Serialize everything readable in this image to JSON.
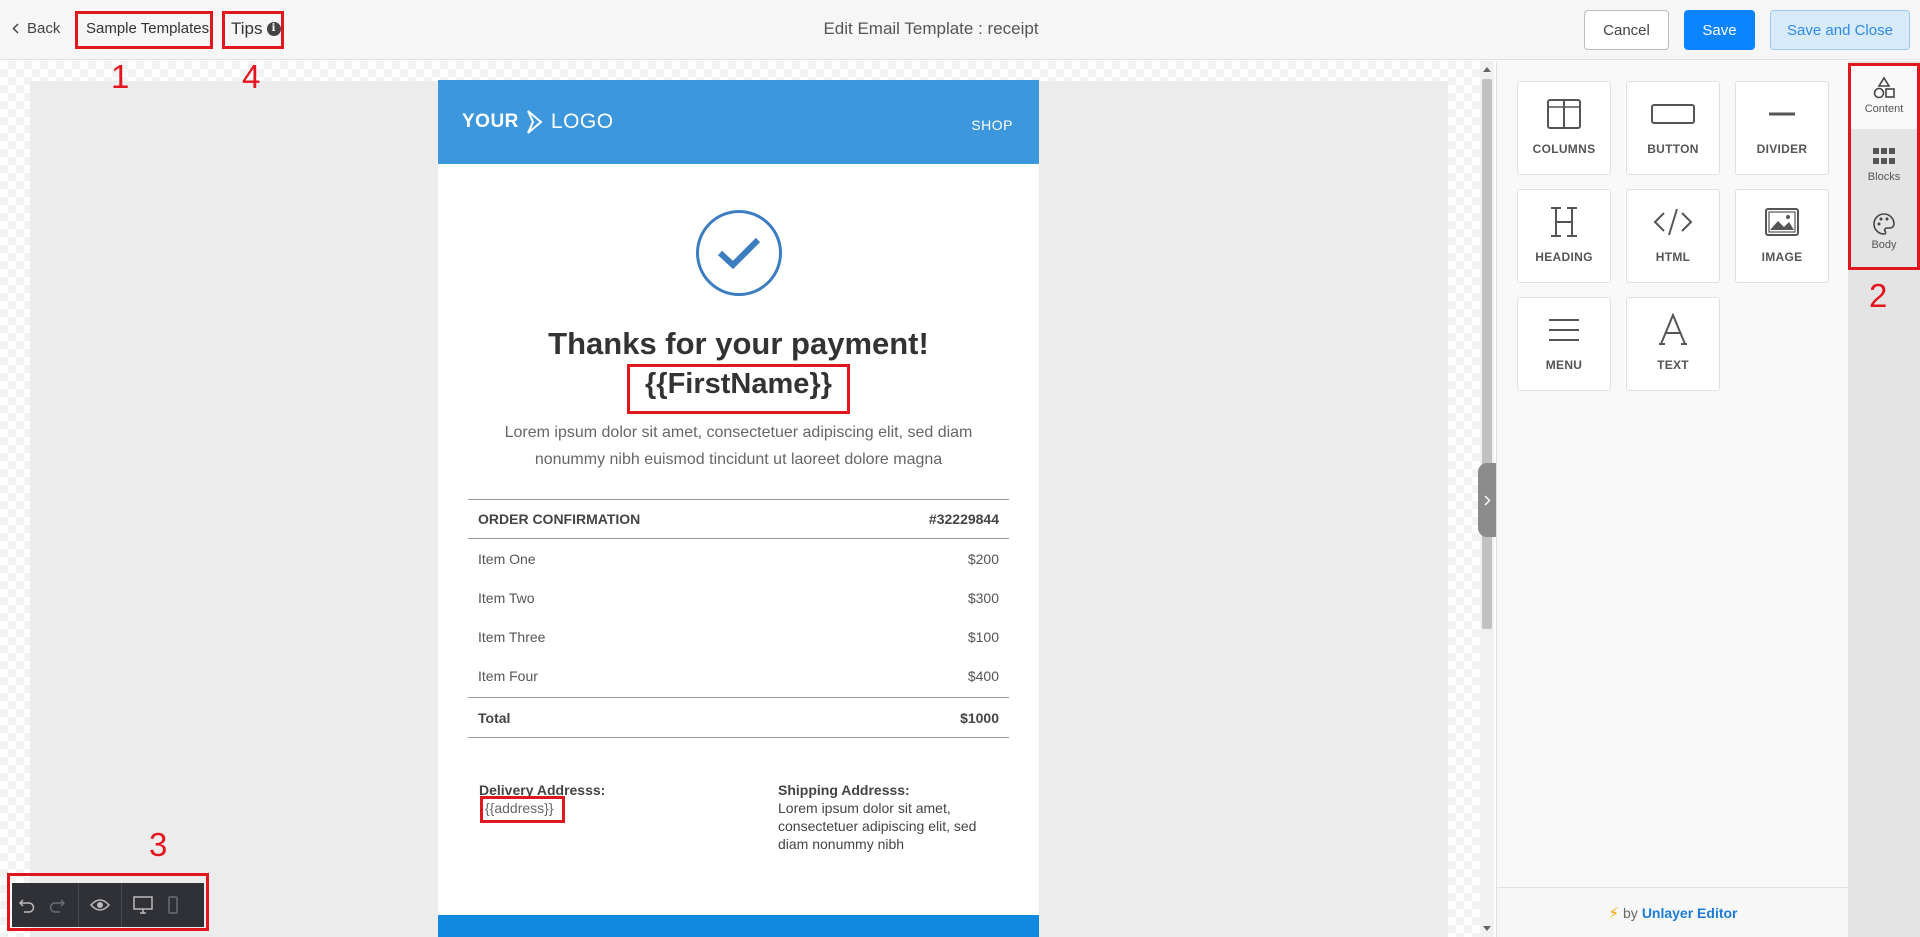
{
  "header": {
    "back_label": "Back",
    "templates_label": "Sample Templates",
    "tips_label": "Tips",
    "tips_info_glyph": "i",
    "title": "Edit Email Template : receipt",
    "cancel_label": "Cancel",
    "save_label": "Save",
    "save_close_label": "Save and Close"
  },
  "annotations": {
    "n1": "1",
    "n2": "2",
    "n3": "3",
    "n4": "4"
  },
  "email": {
    "logo_word1": "YOUR",
    "logo_word2": "LOGO",
    "shop_label": "SHOP",
    "heading": "Thanks for your payment!",
    "first_name_tag": "{{FirstName}}",
    "intro": "Lorem ipsum dolor sit amet, consectetuer adipiscing elit, sed diam nonummy nibh euismod tincidunt ut laoreet dolore magna",
    "order": {
      "title": "ORDER CONFIRMATION",
      "number": "#32229844",
      "items": [
        {
          "name": "Item One",
          "price": "$200"
        },
        {
          "name": "Item Two",
          "price": "$300"
        },
        {
          "name": "Item Three",
          "price": "$100"
        },
        {
          "name": "Item Four",
          "price": "$400"
        }
      ],
      "total_label": "Total",
      "total_value": "$1000"
    },
    "delivery_label": "Delivery Addresss:",
    "delivery_value": "{{address}}",
    "shipping_label": "Shipping Addresss:",
    "shipping_value": "Lorem ipsum dolor sit amet, consectetuer adipiscing elit, sed diam nonummy nibh",
    "colors": {
      "header": "#3c97dd",
      "check": "#3c7cc0",
      "footer": "#0f8ae0"
    }
  },
  "tools": [
    {
      "label": "COLUMNS",
      "icon": "columns-icon"
    },
    {
      "label": "BUTTON",
      "icon": "button-icon"
    },
    {
      "label": "DIVIDER",
      "icon": "divider-icon"
    },
    {
      "label": "HEADING",
      "icon": "heading-icon"
    },
    {
      "label": "HTML",
      "icon": "html-icon"
    },
    {
      "label": "IMAGE",
      "icon": "image-icon"
    },
    {
      "label": "MENU",
      "icon": "menu-icon"
    },
    {
      "label": "TEXT",
      "icon": "text-icon"
    }
  ],
  "side_tabs": [
    {
      "label": "Content",
      "icon": "shapes-icon",
      "active": true
    },
    {
      "label": "Blocks",
      "icon": "grid-icon"
    },
    {
      "label": "Body",
      "icon": "palette-icon"
    }
  ],
  "footer": {
    "by": "by",
    "brand": "Unlayer Editor"
  },
  "accent_colors": {
    "save": "#0b84ff",
    "annotation": "#e3161f"
  }
}
